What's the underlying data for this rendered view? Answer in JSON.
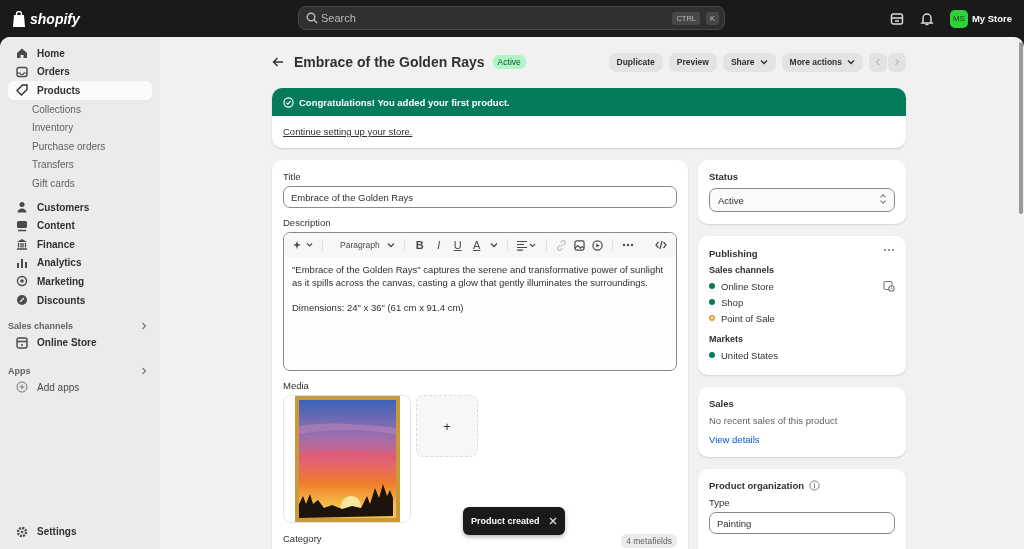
{
  "topbar": {
    "logo": "shopify",
    "search": {
      "placeholder": "Search",
      "keys": [
        "CTRL",
        "K"
      ]
    },
    "avatar": "MS",
    "store": "My Store"
  },
  "sidebar": {
    "items": [
      {
        "label": "Home",
        "kind": "main",
        "selected": false
      },
      {
        "label": "Orders",
        "kind": "main",
        "selected": false
      },
      {
        "label": "Products",
        "kind": "main",
        "selected": true
      },
      {
        "label": "Collections",
        "kind": "sub",
        "selected": false
      },
      {
        "label": "Inventory",
        "kind": "sub",
        "selected": false
      },
      {
        "label": "Purchase orders",
        "kind": "sub",
        "selected": false
      },
      {
        "label": "Transfers",
        "kind": "sub",
        "selected": false
      },
      {
        "label": "Gift cards",
        "kind": "sub",
        "selected": false
      },
      {
        "label": "Customers",
        "kind": "main",
        "selected": false
      },
      {
        "label": "Content",
        "kind": "main",
        "selected": false
      },
      {
        "label": "Finance",
        "kind": "main",
        "selected": false
      },
      {
        "label": "Analytics",
        "kind": "main",
        "selected": false
      },
      {
        "label": "Marketing",
        "kind": "main",
        "selected": false
      },
      {
        "label": "Discounts",
        "kind": "main",
        "selected": false
      }
    ],
    "sections": [
      {
        "title": "Sales channels",
        "items": [
          {
            "label": "Online Store"
          }
        ]
      },
      {
        "title": "Apps",
        "items": [
          {
            "label": "Add apps"
          }
        ]
      }
    ],
    "settings": "Settings"
  },
  "header": {
    "title": "Embrace of the Golden Rays",
    "badge": "Active",
    "actions": [
      {
        "label": "Duplicate",
        "menu": false
      },
      {
        "label": "Preview",
        "menu": false
      },
      {
        "label": "Share",
        "menu": true
      },
      {
        "label": "More actions",
        "menu": true
      }
    ]
  },
  "banner": {
    "message": "Congratulations! You added your first product.",
    "link": "Continue setting up your store."
  },
  "product": {
    "title_label": "Title",
    "title": "Embrace of the Golden Rays",
    "description_label": "Description",
    "toolbar": {
      "style": "Paragraph",
      "format": [
        "B",
        "I",
        "U",
        "A"
      ]
    },
    "description": [
      "\"Embrace of the Golden Rays\" captures the serene and transformative power of sunlight as it spills across the canvas, casting a glow that gently illuminates the surroundings.",
      "Dimensions: 24\" x 36\" (61 cm x 91.4 cm)"
    ],
    "media_label": "Media",
    "media": [
      {
        "kind": "picture"
      }
    ],
    "add": "+",
    "category_label": "Category",
    "metafields": "4 metafields"
  },
  "status": {
    "label": "Status",
    "value": "Active"
  },
  "publishing": {
    "title": "Publishing",
    "channels_label": "Sales channels",
    "channels": [
      {
        "name": "Online Store",
        "published": true,
        "color": "#047b5d"
      },
      {
        "name": "Shop",
        "published": true,
        "color": "#047b5d"
      },
      {
        "name": "Point of Sale",
        "published": false,
        "color": "#e8a33d"
      }
    ],
    "markets_label": "Markets",
    "markets": [
      {
        "name": "United States",
        "published": true,
        "color": "#047b5d"
      }
    ]
  },
  "sales": {
    "title": "Sales",
    "text": "No recent sales of this product",
    "link": "View details"
  },
  "organization": {
    "title": "Product organization",
    "type_label": "Type",
    "type": "Painting"
  },
  "toast": {
    "text": "Product created"
  }
}
